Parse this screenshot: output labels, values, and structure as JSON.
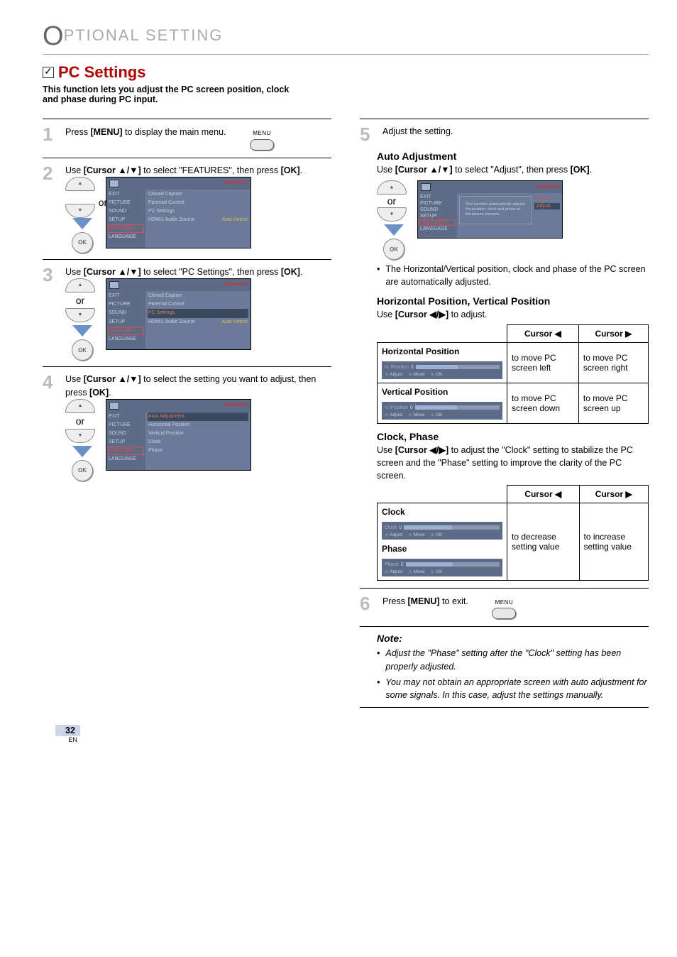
{
  "header": {
    "title_pre": "O",
    "title_rest": "PTIONAL SETTING"
  },
  "section": {
    "title": "PC Settings"
  },
  "intro": "This function lets you adjust the PC screen position, clock and phase during PC input.",
  "steps": {
    "s1": {
      "pre": "Press ",
      "key": "[MENU]",
      "post": " to display the main menu."
    },
    "s2": {
      "pre": "Use ",
      "key": "[Cursor ▲/▼]",
      "mid": " to select \"FEATURES\", then press ",
      "key2": "[OK]",
      "post": "."
    },
    "s3": {
      "pre": "Use ",
      "key": "[Cursor ▲/▼]",
      "mid": " to select \"PC Settings\", then press ",
      "key2": "[OK]",
      "post": "."
    },
    "s4": {
      "pre": "Use ",
      "key": "[Cursor ▲/▼]",
      "mid": " to select the setting you want to adjust, then press ",
      "key2": "[OK]",
      "post": "."
    },
    "s5": "Adjust the setting.",
    "s6": {
      "pre": "Press ",
      "key": "[MENU]",
      "post": " to exit."
    }
  },
  "menu_label": "MENU",
  "or": "or",
  "ok": "OK",
  "osd": {
    "brand": "MAGNAVOX",
    "side": [
      "EXIT",
      "PICTURE",
      "SOUND",
      "SETUP",
      "FEATURES",
      "LANGUAGE"
    ],
    "feat": {
      "items": [
        {
          "l": "Closed Caption",
          "v": ""
        },
        {
          "l": "Parental Control",
          "v": ""
        },
        {
          "l": "PC Settings",
          "v": ""
        },
        {
          "l": "HDMI1 Audio Source",
          "v": "Auto Detect"
        }
      ]
    },
    "pc": {
      "items": [
        {
          "l": "Auto Adjustment",
          "v": ""
        },
        {
          "l": "Horizontal Position",
          "v": ""
        },
        {
          "l": "Vertical Position",
          "v": ""
        },
        {
          "l": "Clock",
          "v": ""
        },
        {
          "l": "Phase",
          "v": ""
        }
      ]
    },
    "adj": {
      "cancel": "Cancel",
      "adjust": "Adjust",
      "desc": "This function automatically adjusts the position, clock and phase of the picture element."
    }
  },
  "auto_adj": {
    "title": "Auto Adjustment",
    "line": {
      "pre": "Use ",
      "key": "[Cursor ▲/▼]",
      "mid": " to select \"Adjust\", then press ",
      "key2": "[OK]",
      "post": "."
    },
    "bullet": "The Horizontal/Vertical position, clock and phase of the PC screen are automatically adjusted."
  },
  "hpvp": {
    "title": "Horizontal Position, Vertical Position",
    "line": {
      "pre": "Use ",
      "key": "[Cursor ◀/▶]",
      "post": " to adjust."
    },
    "col1": "Cursor ◀",
    "col2": "Cursor ▶",
    "hp": "Horizontal Position",
    "vp": "Vertical Position",
    "hp_osd": "H. Position",
    "vp_osd": "V. Position",
    "hp_l": "to move PC screen left",
    "hp_r": "to move PC screen right",
    "vp_l": "to move PC screen down",
    "vp_r": "to move PC screen up",
    "btns": {
      "adjust": "Adjust",
      "move": "Move",
      "ok": "OK"
    },
    "val": "0"
  },
  "cp": {
    "title": "Clock, Phase",
    "line": {
      "pre": "Use ",
      "key": "[Cursor ◀/▶]",
      "post": " to adjust the \"Clock\" setting to stabilize the PC screen and the \"Phase\" setting to improve the clarity of the PC screen."
    },
    "clock": "Clock",
    "phase": "Phase",
    "dec": "to decrease setting value",
    "inc": "to increase setting value",
    "btns": {
      "adjust": "Adjust",
      "move": "Move",
      "ok": "OK"
    },
    "val": "0"
  },
  "note": {
    "title": "Note:",
    "n1": "Adjust the \"Phase\" setting after the \"Clock\" setting has been properly adjusted.",
    "n2": "You may not obtain an appropriate screen with auto adjustment for some signals. In this case, adjust the settings manually."
  },
  "page": {
    "num": "32",
    "lang": "EN"
  }
}
